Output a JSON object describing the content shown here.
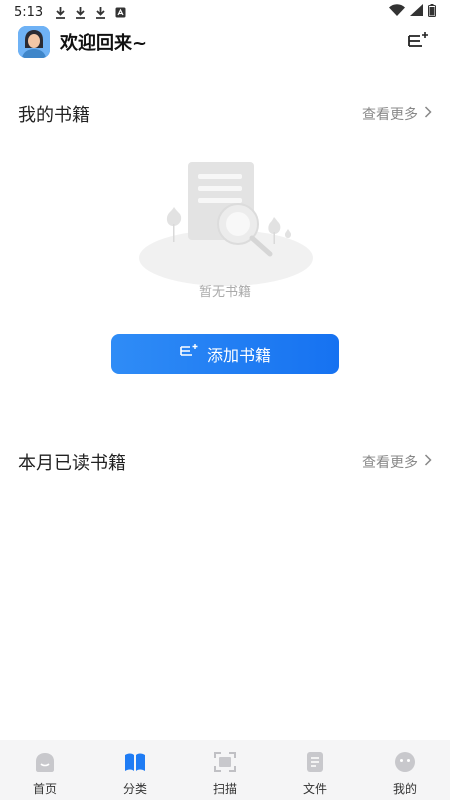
{
  "status_bar": {
    "time": "5:13"
  },
  "header": {
    "welcome": "欢迎回来~"
  },
  "my_books": {
    "title": "我的书籍",
    "more": "查看更多",
    "empty": "暂无书籍",
    "add_button": "添加书籍"
  },
  "monthly_read": {
    "title": "本月已读书籍",
    "more": "查看更多"
  },
  "tabbar": {
    "items": [
      {
        "label": "首页",
        "icon": "home-icon"
      },
      {
        "label": "分类",
        "icon": "category-icon"
      },
      {
        "label": "扫描",
        "icon": "scan-icon"
      },
      {
        "label": "文件",
        "icon": "file-icon"
      },
      {
        "label": "我的",
        "icon": "profile-icon"
      }
    ]
  },
  "colors": {
    "accent": "#1672f1",
    "tabbar_bg": "#f5f5f6"
  }
}
